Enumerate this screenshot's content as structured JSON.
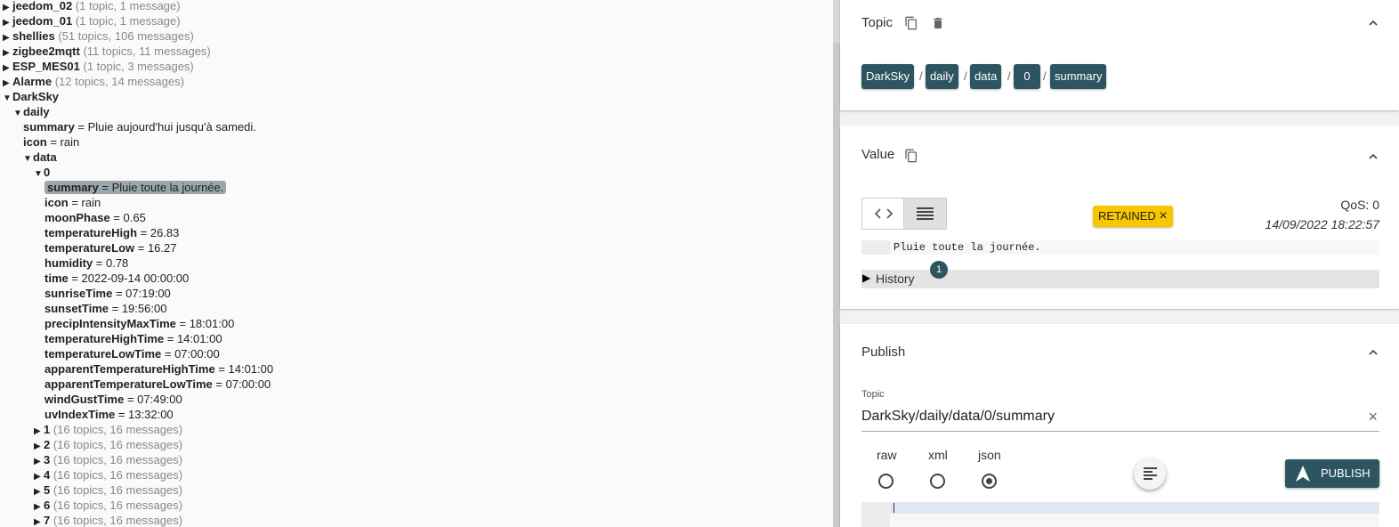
{
  "tree": {
    "rows": [
      {
        "tri": "▶",
        "name": "jeedom_02",
        "rest": "",
        "count": " (1 topic, 1 message)"
      },
      {
        "tri": "▶",
        "name": "jeedom_01",
        "rest": "",
        "count": " (1 topic, 1 message)"
      },
      {
        "tri": "▶",
        "name": "shellies",
        "rest": "",
        "count": " (51 topics, 106 messages)"
      },
      {
        "tri": "▶",
        "name": "zigbee2mqtt",
        "rest": "",
        "count": " (11 topics, 11 messages)"
      },
      {
        "tri": "▶",
        "name": "ESP_MES01",
        "rest": "",
        "count": " (1 topic, 3 messages)"
      },
      {
        "tri": "▶",
        "name": "Alarme",
        "rest": "",
        "count": " (12 topics, 14 messages)"
      },
      {
        "tri": "▼",
        "name": "DarkSky",
        "rest": "",
        "count": ""
      },
      {
        "tri": "▼",
        "name": "daily",
        "rest": "",
        "count": ""
      },
      {
        "tri": "",
        "name": "summary",
        "rest": " = Pluie aujourd'hui jusqu'à samedi.",
        "count": ""
      },
      {
        "tri": "",
        "name": "icon",
        "rest": " = rain",
        "count": ""
      },
      {
        "tri": "▼",
        "name": "data",
        "rest": "",
        "count": ""
      },
      {
        "tri": "▼",
        "name": "0",
        "rest": "",
        "count": ""
      },
      {
        "tri": "",
        "name": "summary",
        "rest": " = Pluie toute la journée.",
        "count": ""
      },
      {
        "tri": "",
        "name": "icon",
        "rest": " = rain",
        "count": ""
      },
      {
        "tri": "",
        "name": "moonPhase",
        "rest": " = 0.65",
        "count": ""
      },
      {
        "tri": "",
        "name": "temperatureHigh",
        "rest": " = 26.83",
        "count": ""
      },
      {
        "tri": "",
        "name": "temperatureLow",
        "rest": " = 16.27",
        "count": ""
      },
      {
        "tri": "",
        "name": "humidity",
        "rest": " = 0.78",
        "count": ""
      },
      {
        "tri": "",
        "name": "time",
        "rest": " = 2022-09-14 00:00:00",
        "count": ""
      },
      {
        "tri": "",
        "name": "sunriseTime",
        "rest": " = 07:19:00",
        "count": ""
      },
      {
        "tri": "",
        "name": "sunsetTime",
        "rest": " = 19:56:00",
        "count": ""
      },
      {
        "tri": "",
        "name": "precipIntensityMaxTime",
        "rest": " = 18:01:00",
        "count": ""
      },
      {
        "tri": "",
        "name": "temperatureHighTime",
        "rest": " = 14:01:00",
        "count": ""
      },
      {
        "tri": "",
        "name": "temperatureLowTime",
        "rest": " = 07:00:00",
        "count": ""
      },
      {
        "tri": "",
        "name": "apparentTemperatureHighTime",
        "rest": " = 14:01:00",
        "count": ""
      },
      {
        "tri": "",
        "name": "apparentTemperatureLowTime",
        "rest": " = 07:00:00",
        "count": ""
      },
      {
        "tri": "",
        "name": "windGustTime",
        "rest": " = 07:49:00",
        "count": ""
      },
      {
        "tri": "",
        "name": "uvIndexTime",
        "rest": " = 13:32:00",
        "count": ""
      },
      {
        "tri": "▶",
        "name": "1",
        "rest": "",
        "count": " (16 topics, 16 messages)"
      },
      {
        "tri": "▶",
        "name": "2",
        "rest": "",
        "count": " (16 topics, 16 messages)"
      },
      {
        "tri": "▶",
        "name": "3",
        "rest": "",
        "count": " (16 topics, 16 messages)"
      },
      {
        "tri": "▶",
        "name": "4",
        "rest": "",
        "count": " (16 topics, 16 messages)"
      },
      {
        "tri": "▶",
        "name": "5",
        "rest": "",
        "count": " (16 topics, 16 messages)"
      },
      {
        "tri": "▶",
        "name": "6",
        "rest": "",
        "count": " (16 topics, 16 messages)"
      },
      {
        "tri": "▶",
        "name": "7",
        "rest": "",
        "count": " (16 topics, 16 messages)"
      }
    ]
  },
  "topic_card": {
    "title": "Topic",
    "crumbs": [
      "DarkSky",
      "daily",
      "data",
      "0",
      "summary"
    ],
    "separator": "/"
  },
  "value_card": {
    "title": "Value",
    "retained_label": "RETAINED",
    "retained_close": "×",
    "qos": "QoS: 0",
    "timestamp": "14/09/2022 18:22:57",
    "value_text": "Pluie toute la journée.",
    "history_label": "History",
    "history_count": "1"
  },
  "publish_card": {
    "title": "Publish",
    "topic_label": "Topic",
    "topic_value": "DarkSky/daily/data/0/summary",
    "clear": "×",
    "formats": [
      "raw",
      "xml",
      "json"
    ],
    "selected_format": "json",
    "publish_label": "PUBLISH"
  },
  "colors": {
    "accent": "#2d5561",
    "retained": "#f9c700",
    "selection": "#9aa8ae"
  }
}
